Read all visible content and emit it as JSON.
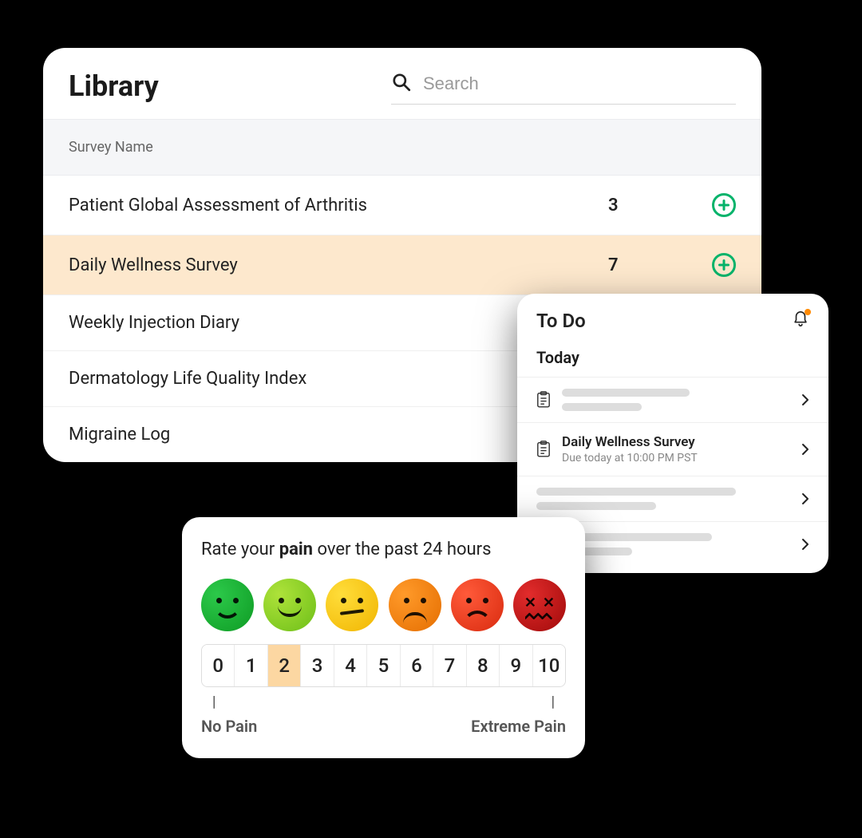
{
  "library": {
    "title": "Library",
    "search_placeholder": "Search",
    "column_header": "Survey Name",
    "rows": [
      {
        "name": "Patient Global Assessment of Arthritis",
        "count": "3"
      },
      {
        "name": "Daily Wellness Survey",
        "count": "7"
      },
      {
        "name": "Weekly Injection Diary",
        "count": ""
      },
      {
        "name": "Dermatology Life Quality Index",
        "count": ""
      },
      {
        "name": "Migraine Log",
        "count": ""
      }
    ]
  },
  "todo": {
    "title": "To Do",
    "section": "Today",
    "item_title": "Daily Wellness Survey",
    "item_sub": "Due today at 10:00 PM PST"
  },
  "pain": {
    "prompt_pre": "Rate your ",
    "prompt_bold": "pain",
    "prompt_post": " over the past 24 hours",
    "scale": [
      "0",
      "1",
      "2",
      "3",
      "4",
      "5",
      "6",
      "7",
      "8",
      "9",
      "10"
    ],
    "selected_index": 2,
    "anchor_low": "No Pain",
    "anchor_high": "Extreme Pain",
    "tick": "|"
  },
  "colors": {
    "highlight_row": "#fde8cd",
    "accent_green": "#05b36a",
    "notif_dot": "#ff8a00"
  }
}
